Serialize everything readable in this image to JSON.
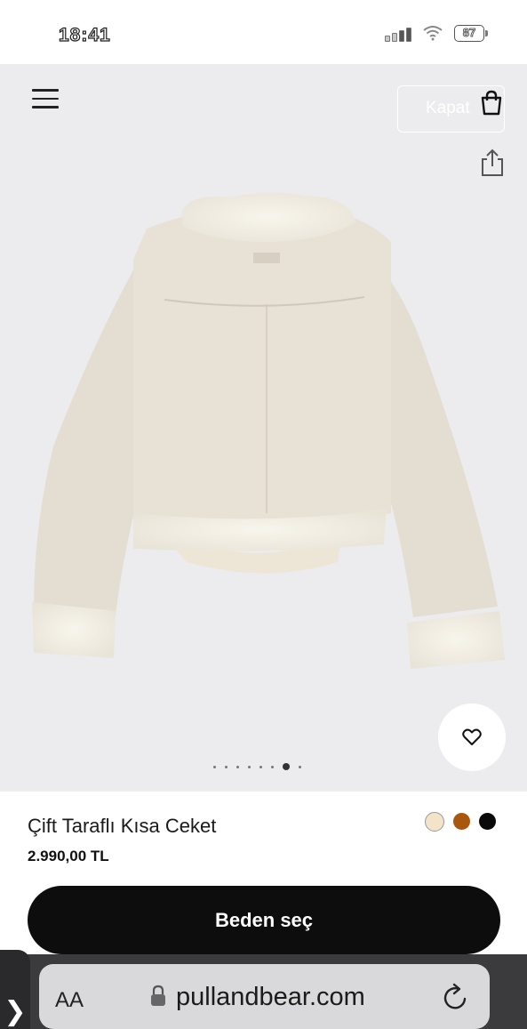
{
  "status_bar": {
    "time": "18:41",
    "battery": "87"
  },
  "header": {
    "close_label": "Kapat",
    "menu_icon": "menu-icon",
    "bag_icon": "shopping-bag-icon",
    "share_icon": "share-icon"
  },
  "gallery": {
    "image_count": 8,
    "active_index": 6
  },
  "product": {
    "name": "Çift Taraflı Kısa Ceket",
    "price": "2.990,00 TL",
    "colors": [
      "#f3e3c8",
      "#a8570d",
      "#0a0a0a"
    ],
    "selected_color_index": 0
  },
  "actions": {
    "select_size": "Beden seç"
  },
  "browser": {
    "aa_label": "AA",
    "url": "pullandbear.com",
    "back_label": "❯"
  }
}
